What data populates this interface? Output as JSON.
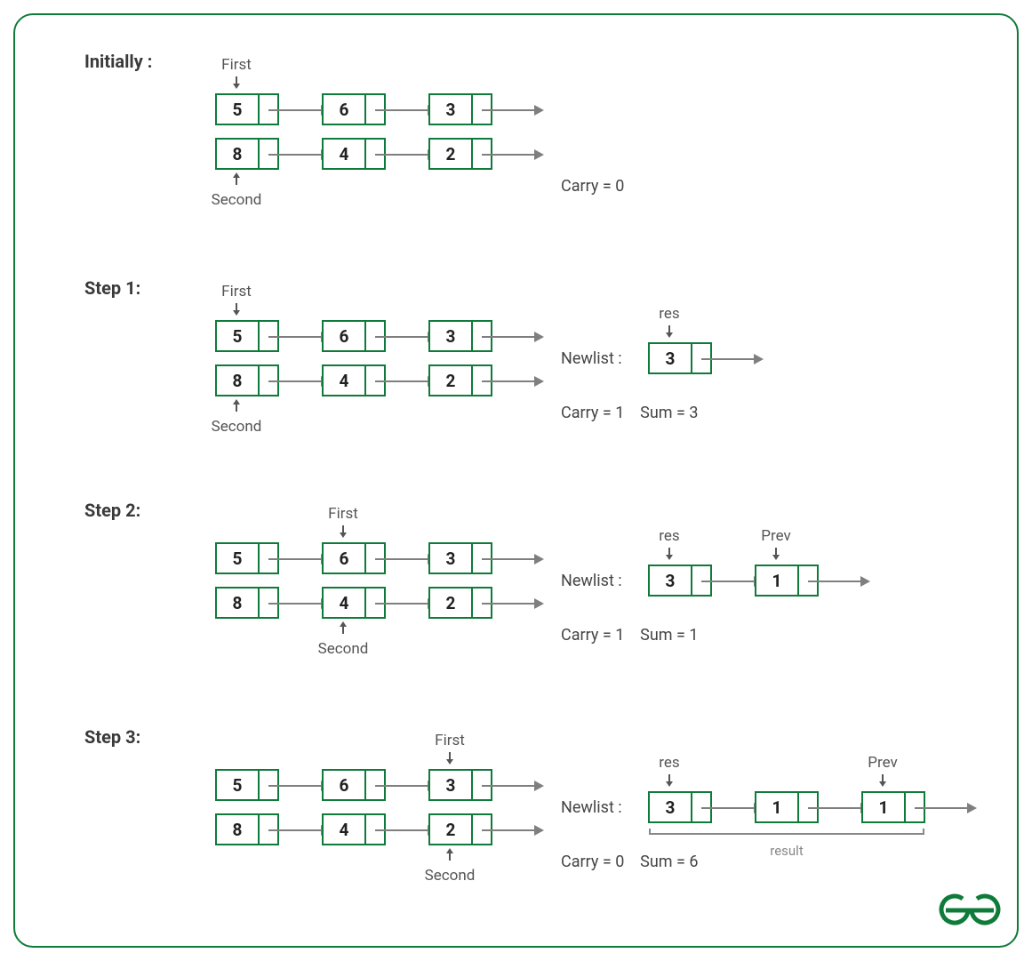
{
  "steps": [
    {
      "title": "Initially :",
      "first_label": "First",
      "second_label": "Second",
      "first_index": 0,
      "second_index": 0,
      "list1": [
        5,
        6,
        3
      ],
      "list2": [
        8,
        4,
        2
      ],
      "newlist_label": "",
      "newlist": [],
      "res_index": null,
      "prev_index": null,
      "status": "Carry = 0"
    },
    {
      "title": "Step 1:",
      "first_label": "First",
      "second_label": "Second",
      "first_index": 0,
      "second_index": 0,
      "list1": [
        5,
        6,
        3
      ],
      "list2": [
        8,
        4,
        2
      ],
      "newlist_label": "Newlist :",
      "newlist": [
        3
      ],
      "res_label": "res",
      "res_index": 0,
      "prev_index": null,
      "status": "Carry = 1    Sum = 3"
    },
    {
      "title": "Step 2:",
      "first_label": "First",
      "second_label": "Second",
      "first_index": 1,
      "second_index": 1,
      "list1": [
        5,
        6,
        3
      ],
      "list2": [
        8,
        4,
        2
      ],
      "newlist_label": "Newlist :",
      "newlist": [
        3,
        1
      ],
      "res_label": "res",
      "prev_label": "Prev",
      "res_index": 0,
      "prev_index": 1,
      "status": "Carry = 1    Sum = 1"
    },
    {
      "title": "Step 3:",
      "first_label": "First",
      "second_label": "Second",
      "first_index": 2,
      "second_index": 2,
      "list1": [
        5,
        6,
        3
      ],
      "list2": [
        8,
        4,
        2
      ],
      "newlist_label": "Newlist :",
      "newlist": [
        3,
        1,
        1
      ],
      "res_label": "res",
      "prev_label": "Prev",
      "res_index": 0,
      "prev_index": 2,
      "result_label": "result",
      "status": "Carry = 0    Sum = 6"
    }
  ],
  "logo": "G"
}
